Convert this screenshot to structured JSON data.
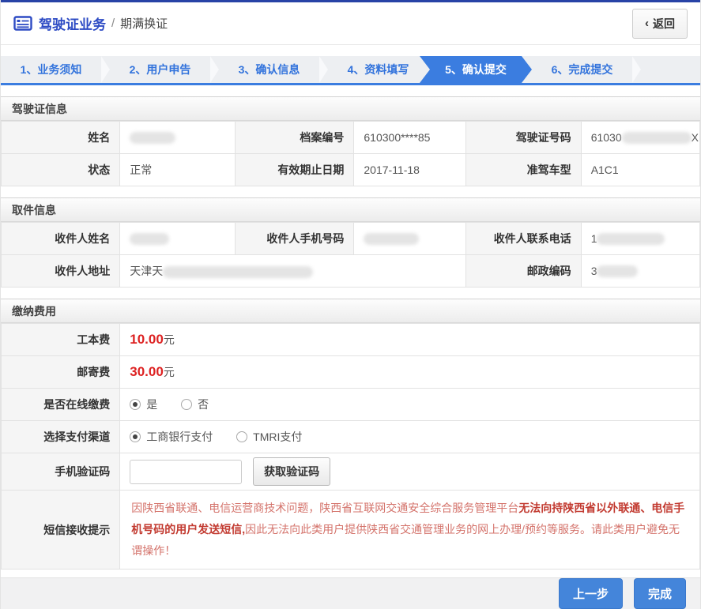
{
  "header": {
    "title": "驾驶证业务",
    "separator": "/",
    "subtitle": "期满换证",
    "back_arrow": "‹",
    "back_label": "返回"
  },
  "steps": [
    {
      "label": "1、业务须知",
      "active": false
    },
    {
      "label": "2、用户申告",
      "active": false
    },
    {
      "label": "3、确认信息",
      "active": false
    },
    {
      "label": "4、资料填写",
      "active": false
    },
    {
      "label": "5、确认提交",
      "active": true
    },
    {
      "label": "6、完成提交",
      "active": false
    }
  ],
  "license": {
    "title": "驾驶证信息",
    "name_label": "姓名",
    "file_no_label": "档案编号",
    "file_no_value": "610300****85",
    "license_no_label": "驾驶证号码",
    "license_no_prefix": "61030",
    "license_no_suffix": "X",
    "status_label": "状态",
    "status_value": "正常",
    "expiry_label": "有效期止日期",
    "expiry_value": "2017-11-18",
    "vehicle_label": "准驾车型",
    "vehicle_value": "A1C1"
  },
  "pickup": {
    "title": "取件信息",
    "recipient_name_label": "收件人姓名",
    "recipient_mobile_label": "收件人手机号码",
    "recipient_phone_label": "收件人联系电话",
    "recipient_phone_prefix": "1",
    "recipient_address_label": "收件人地址",
    "recipient_address_prefix": "天津天",
    "postal_code_label": "邮政编码",
    "postal_code_prefix": "3"
  },
  "fees": {
    "title": "缴纳费用",
    "production_fee_label": "工本费",
    "production_fee_value": "10.00",
    "postage_fee_label": "邮寄费",
    "postage_fee_value": "30.00",
    "currency": "元",
    "online_payment_label": "是否在线缴费",
    "online_yes": "是",
    "online_no": "否",
    "online_selected": "是",
    "channel_label": "选择支付渠道",
    "channel_icbc": "工商银行支付",
    "channel_tmri": "TMRI支付",
    "channel_selected": "工商银行支付",
    "sms_code_label": "手机验证码",
    "sms_code_value": "",
    "get_code_button": "获取验证码",
    "notice_label": "短信接收提示",
    "notice_part1": "因陕西省联通、电信运营商技术问题，陕西省互联网交通安全综合服务管理平台",
    "notice_part2": "无法向持陕西省以外联通、电信手机号码的用户发送短信,",
    "notice_part3": "因此无法向此类用户提供陕西省交通管理业务的网上办理/预约等服务。请此类用户避免无谓操作！"
  },
  "footer": {
    "prev_button": "上一步",
    "finish_button": "完成"
  },
  "colors": {
    "topbar_blue": "#2843a6",
    "title_blue": "#2d4bc4",
    "step_active_blue": "#3b7de0",
    "button_blue": "#4485da",
    "price_red": "#dd2222",
    "notice_red": "#c23a30"
  }
}
